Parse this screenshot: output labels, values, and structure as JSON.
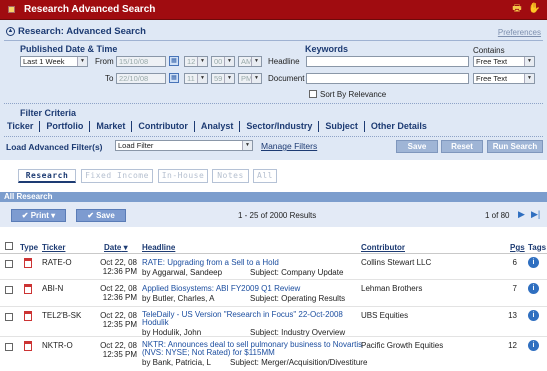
{
  "window": {
    "title": "Research Advanced Search"
  },
  "header": {
    "title": "Research: Advanced Search",
    "preferences": "Preferences"
  },
  "filters": {
    "date_title": "Published Date & Time",
    "date_range": "Last 1 Week",
    "from_label": "From",
    "from_date": "15/10/08",
    "from_hour": "12",
    "from_min": "00",
    "from_ampm": "AM",
    "to_label": "To",
    "to_date": "22/10/08",
    "to_hour": "11",
    "to_min": "59",
    "to_ampm": "PM",
    "keywords_title": "Keywords",
    "headline_label": "Headline",
    "document_label": "Document",
    "contains_label": "Contains",
    "headline_contains": "Free Text",
    "document_contains": "Free Text",
    "sort_relevance": "Sort By Relevance",
    "criteria_title": "Filter Criteria",
    "criteria_tabs": [
      "Ticker",
      "Portfolio",
      "Market",
      "Contributor",
      "Analyst",
      "Sector/Industry",
      "Subject",
      "Other Details"
    ],
    "load_label": "Load Advanced Filter(s)",
    "load_value": "Load Filter",
    "manage": "Manage Filters",
    "save": "Save",
    "reset": "Reset",
    "run": "Run Search"
  },
  "tabs": [
    "Research",
    "Fixed Income",
    "In-House",
    "Notes",
    "All"
  ],
  "results": {
    "section_title": "All Research",
    "print": "Print",
    "save": "Save",
    "summary": "1 - 25 of 2000 Results",
    "page": "1 of 80",
    "columns": [
      "Type",
      "Ticker",
      "Date",
      "Headline",
      "Contributor",
      "Pgs",
      "Tags"
    ],
    "rows": [
      {
        "ticker": "RATE-O",
        "date": "Oct 22, 08",
        "time": "12:36 PM",
        "headline": "RATE: Upgrading from a Sell to a Hold",
        "by": "by Aggarwal, Sandeep",
        "subject": "Subject: Company Update",
        "contributor": "Collins Stewart LLC",
        "pgs": "6"
      },
      {
        "ticker": "ABI-N",
        "date": "Oct 22, 08",
        "time": "12:36 PM",
        "headline": "Applied Biosystems: ABI FY2009 Q1 Review",
        "by": "by Butler, Charles, A",
        "subject": "Subject: Operating Results",
        "contributor": "Lehman Brothers",
        "pgs": "7"
      },
      {
        "ticker": "TEL2'B-SK",
        "date": "Oct 22, 08",
        "time": "12:35 PM",
        "headline": "TeleDaily - US Version \"Research in Focus\" 22-Oct-2008",
        "headline2": "Hodulik",
        "by": "by Hodulik, John",
        "subject": "Subject: Industry Overview",
        "contributor": "UBS Equities",
        "pgs": "13"
      },
      {
        "ticker": "NKTR-O",
        "date": "Oct 22, 08",
        "time": "12:35 PM",
        "headline": "NKTR: Announces deal to sell pulmonary business to Novartis",
        "headline2": "(NVS: NYSE; Not Rated) for $115MM",
        "by": "by Bank, Patricia, L",
        "subject": "Subject: Merger/Acquisition/Divestiture",
        "contributor": "Pacific Growth Equities",
        "pgs": "12"
      }
    ]
  }
}
